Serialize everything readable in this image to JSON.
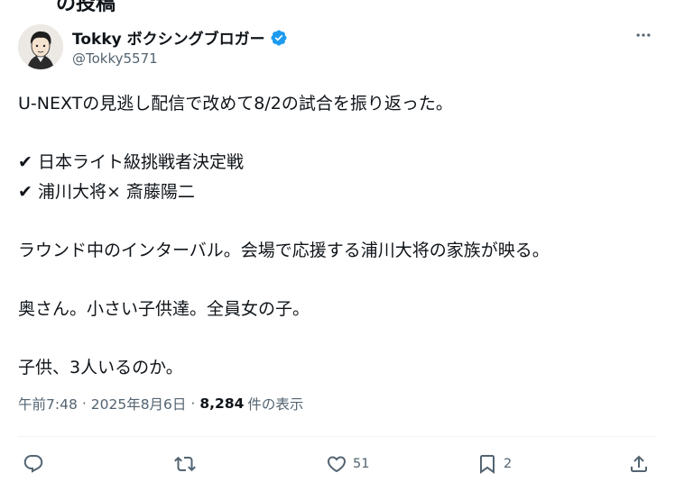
{
  "header_fragment": "の投稿",
  "author": {
    "display_name": "Tokky ボクシングブロガー",
    "handle": "@Tokky5571",
    "verified": true
  },
  "post": {
    "lines": [
      "U-NEXTの見逃し配信で改めて8/2の試合を振り返った。",
      "",
      "✔ 日本ライト級挑戦者決定戦",
      "✔ 浦川大将× 斎藤陽二",
      "",
      "ラウンド中のインターバル。会場で応援する浦川大将の家族が映る。",
      "",
      "奥さん。小さい子供達。全員女の子。",
      "",
      "子供、3人いるのか。"
    ],
    "time": "午前7:48",
    "separator": "·",
    "date": "2025年8月6日",
    "views_count": "8,284",
    "views_label": "件の表示"
  },
  "actions": {
    "reply_count": "",
    "repost_count": "",
    "like_count": "51",
    "bookmark_count": "2"
  },
  "icons": {
    "more": "more-horizontal-icon",
    "verified": "verified-badge-icon",
    "reply": "reply-icon",
    "repost": "repost-icon",
    "like": "heart-icon",
    "bookmark": "bookmark-icon",
    "share": "share-icon"
  },
  "colors": {
    "text": "#0f1419",
    "secondary": "#536471",
    "verified": "#1d9bf0",
    "divider": "#eff3f4"
  }
}
